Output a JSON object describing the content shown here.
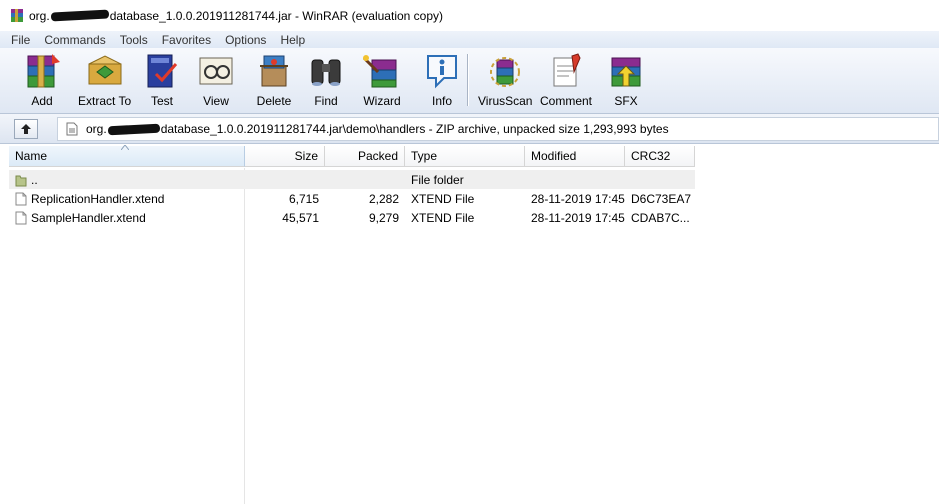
{
  "window": {
    "title_prefix": "org.",
    "title_suffix": "database_1.0.0.201911281744.jar - WinRAR (evaluation copy)"
  },
  "menu": [
    "File",
    "Commands",
    "Tools",
    "Favorites",
    "Options",
    "Help"
  ],
  "toolbar": {
    "add": "Add",
    "extract_to": "Extract To",
    "test": "Test",
    "view": "View",
    "delete": "Delete",
    "find": "Find",
    "wizard": "Wizard",
    "info": "Info",
    "virusscan": "VirusScan",
    "comment": "Comment",
    "sfx": "SFX"
  },
  "address": {
    "prefix": "org.",
    "suffix": "database_1.0.0.201911281744.jar\\demo\\handlers - ZIP archive, unpacked size 1,293,993 bytes"
  },
  "columns": {
    "name": "Name",
    "size": "Size",
    "packed": "Packed",
    "type": "Type",
    "modified": "Modified",
    "crc": "CRC32"
  },
  "rows": [
    {
      "name": "..",
      "size": "",
      "packed": "",
      "type": "File folder",
      "modified": "",
      "crc": ""
    },
    {
      "name": "ReplicationHandler.xtend",
      "size": "6,715",
      "packed": "2,282",
      "type": "XTEND File",
      "modified": "28-11-2019 17:45",
      "crc": "D6C73EA7"
    },
    {
      "name": "SampleHandler.xtend",
      "size": "45,571",
      "packed": "9,279",
      "type": "XTEND File",
      "modified": "28-11-2019 17:45",
      "crc": "CDAB7C..."
    }
  ]
}
